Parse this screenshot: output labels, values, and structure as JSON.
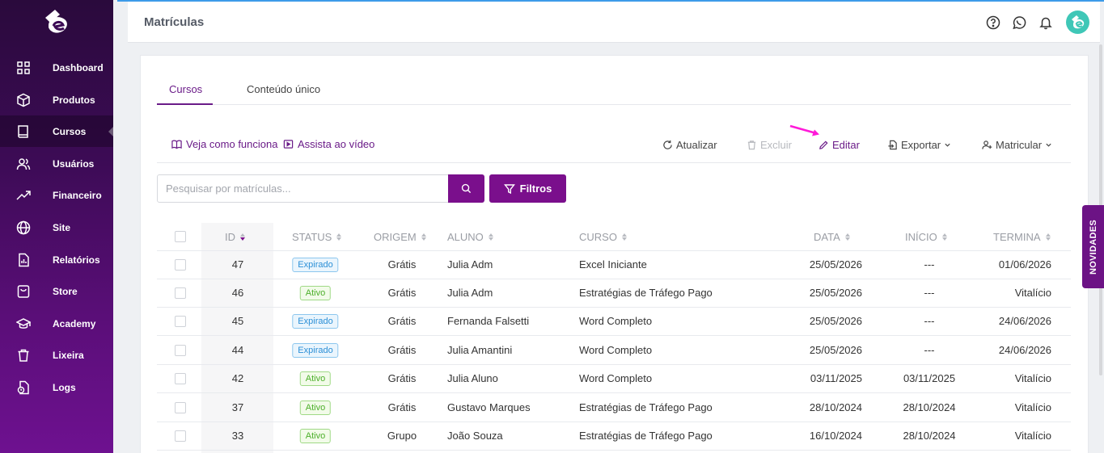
{
  "header": {
    "title": "Matrículas"
  },
  "sidebar": {
    "items": [
      {
        "label": "Dashboard",
        "icon": "grid-icon"
      },
      {
        "label": "Produtos",
        "icon": "box-icon"
      },
      {
        "label": "Cursos",
        "icon": "book-icon",
        "active": true
      },
      {
        "label": "Usuários",
        "icon": "users-icon"
      },
      {
        "label": "Financeiro",
        "icon": "trending-up-icon"
      },
      {
        "label": "Site",
        "icon": "globe-icon"
      },
      {
        "label": "Relatórios",
        "icon": "report-icon"
      },
      {
        "label": "Store",
        "icon": "shopping-bag-icon"
      },
      {
        "label": "Academy",
        "icon": "graduation-cap-icon"
      },
      {
        "label": "Lixeira",
        "icon": "trash-icon"
      },
      {
        "label": "Logs",
        "icon": "logs-icon"
      }
    ]
  },
  "tabs": {
    "cursos": "Cursos",
    "conteudo": "Conteúdo único"
  },
  "links": {
    "veja": "Veja como funciona",
    "assista": "Assista ao vídeo"
  },
  "actions": {
    "atualizar": "Atualizar",
    "excluir": "Excluir",
    "editar": "Editar",
    "exportar": "Exportar",
    "matricular": "Matricular"
  },
  "search": {
    "placeholder": "Pesquisar por matrículas...",
    "filters_label": "Filtros"
  },
  "table": {
    "columns": {
      "id": "ID",
      "status": "STATUS",
      "origem": "ORIGEM",
      "aluno": "ALUNO",
      "curso": "CURSO",
      "data": "DATA",
      "inicio": "INÍCIO",
      "termina": "TERMINA"
    },
    "rows": [
      {
        "id": "47",
        "status": "Expirado",
        "origem": "Grátis",
        "aluno": "Julia Adm",
        "curso": "Excel Iniciante",
        "data": "25/05/2026",
        "inicio": "---",
        "termina": "01/06/2026"
      },
      {
        "id": "46",
        "status": "Ativo",
        "origem": "Grátis",
        "aluno": "Julia Adm",
        "curso": "Estratégias de Tráfego Pago",
        "data": "25/05/2026",
        "inicio": "---",
        "termina": "Vitalício"
      },
      {
        "id": "45",
        "status": "Expirado",
        "origem": "Grátis",
        "aluno": "Fernanda Falsetti",
        "curso": "Word Completo",
        "data": "25/05/2026",
        "inicio": "---",
        "termina": "24/06/2026"
      },
      {
        "id": "44",
        "status": "Expirado",
        "origem": "Grátis",
        "aluno": "Julia Amantini",
        "curso": "Word Completo",
        "data": "25/05/2026",
        "inicio": "---",
        "termina": "24/06/2026"
      },
      {
        "id": "42",
        "status": "Ativo",
        "origem": "Grátis",
        "aluno": "Julia Aluno",
        "curso": "Word Completo",
        "data": "03/11/2025",
        "inicio": "03/11/2025",
        "termina": "Vitalício"
      },
      {
        "id": "37",
        "status": "Ativo",
        "origem": "Grátis",
        "aluno": "Gustavo Marques",
        "curso": "Estratégias de Tráfego Pago",
        "data": "28/10/2024",
        "inicio": "28/10/2024",
        "termina": "Vitalício"
      },
      {
        "id": "33",
        "status": "Ativo",
        "origem": "Grupo",
        "aluno": "João Souza",
        "curso": "Estratégias de Tráfego Pago",
        "data": "16/10/2024",
        "inicio": "28/10/2024",
        "termina": "Vitalício"
      }
    ]
  },
  "novidades": "NOVIDADES",
  "colors": {
    "brand": "#7a0f8c",
    "sidebar_top": "#2a0a3c",
    "sidebar_bottom": "#6e1190",
    "expired": "#2b8fd6",
    "active": "#4caf2a",
    "annotation_arrow": "#ff1ad9"
  }
}
